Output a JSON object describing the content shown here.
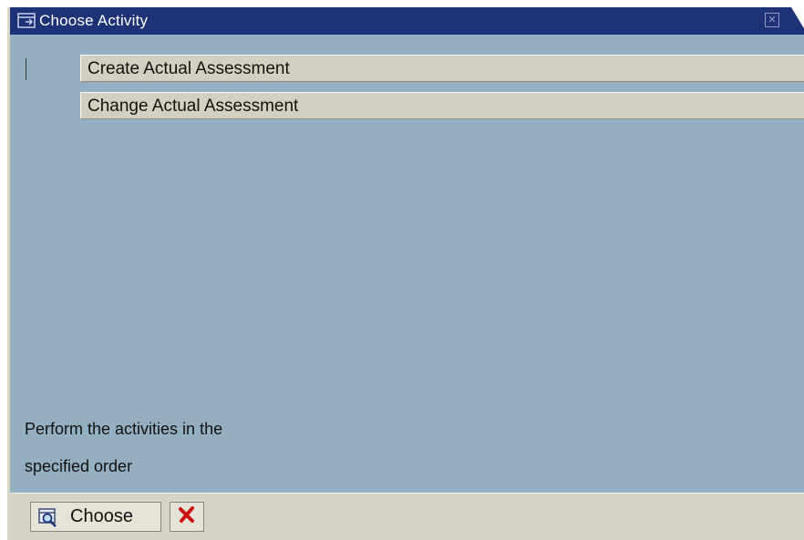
{
  "dialog": {
    "title": "Choose Activity",
    "title_icon": "dialog-window-icon",
    "close_icon": "close-icon"
  },
  "activities": [
    {
      "label": "Create Actual Assessment"
    },
    {
      "label": "Change Actual Assessment"
    }
  ],
  "hint": {
    "line1": "Perform the activities in the",
    "line2": "specified order"
  },
  "footer": {
    "choose_label": "Choose",
    "choose_icon": "choose-magnifier-icon",
    "cancel_icon": "cancel-x-icon"
  },
  "colors": {
    "titlebar": "#1d3277",
    "panel": "#93afc1",
    "button_face": "#d4d0c1",
    "cancel_red": "#cc1111"
  }
}
